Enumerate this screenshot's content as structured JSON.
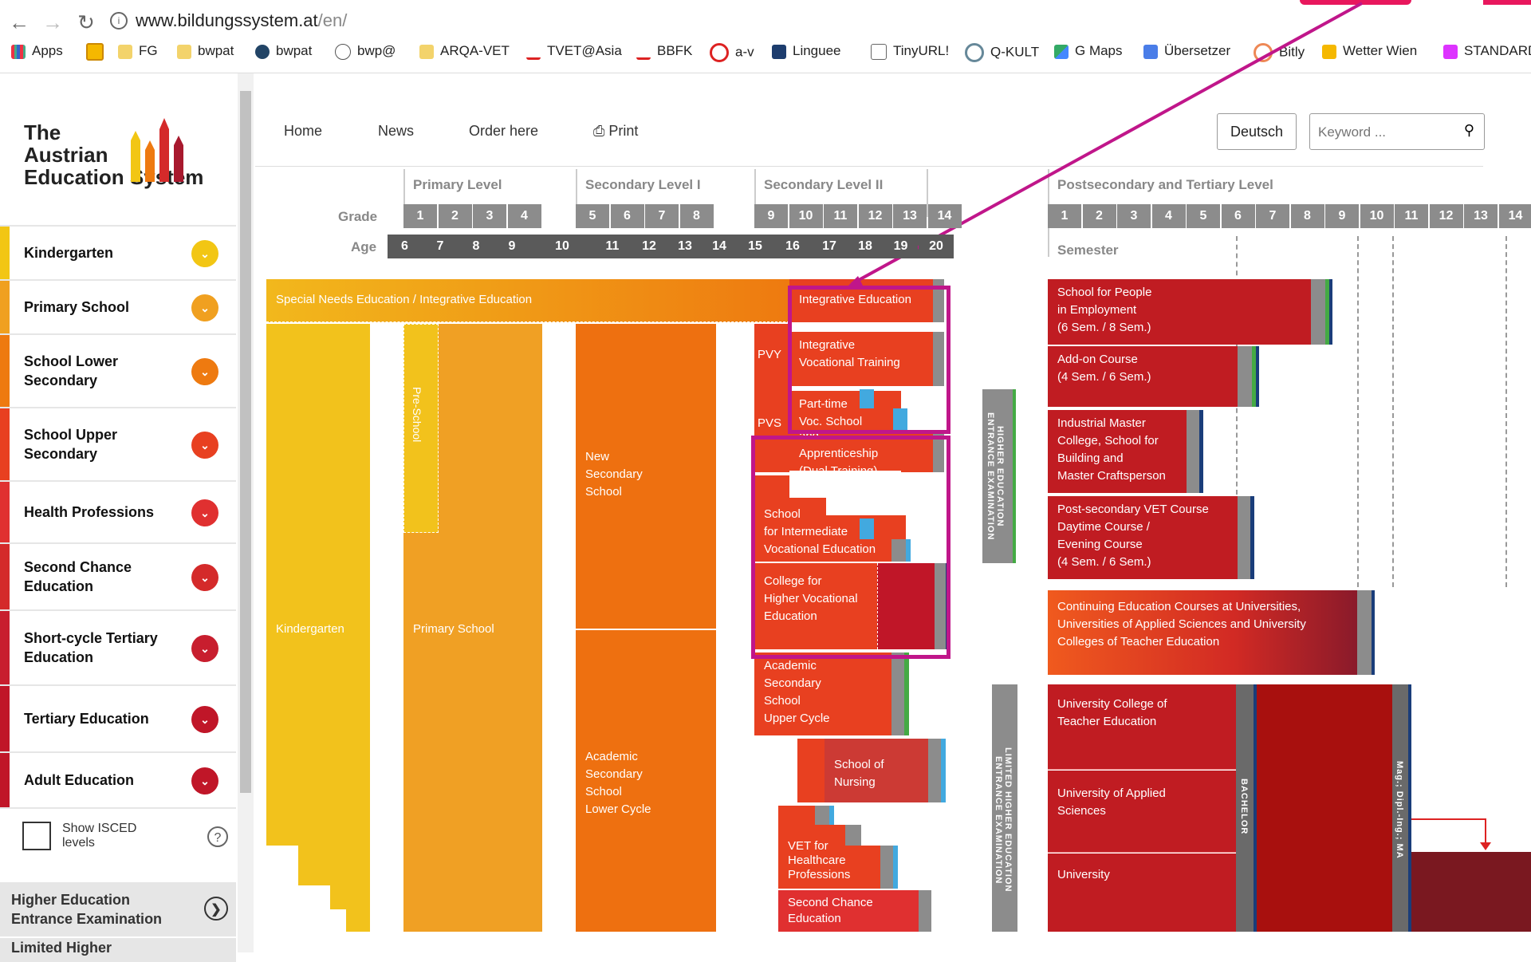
{
  "browser": {
    "url_host": "www.bildungssystem.at",
    "url_path": "/en/",
    "bookmarks": [
      "Apps",
      "FG",
      "bwpat",
      "bwpat",
      "bwp@",
      "ARQA-VET",
      "TVET@Asia",
      "BBFK",
      "a-v",
      "Linguee",
      "TinyURL!",
      "Q-KULT",
      "G Maps",
      "Übersetzer",
      "Bitly",
      "Wetter Wien",
      "STANDARD"
    ]
  },
  "logo": {
    "line1": "The",
    "line2": "Austrian",
    "line3": "Education System"
  },
  "sidebar": {
    "items": [
      {
        "label1": "Kindergarten",
        "label2": "",
        "color": "#f2c614"
      },
      {
        "label1": "Primary School",
        "label2": "",
        "color": "#f0a020"
      },
      {
        "label1": "School Lower",
        "label2": "Secondary",
        "color": "#ee7a10"
      },
      {
        "label1": "School Upper",
        "label2": "Secondary",
        "color": "#e84020"
      },
      {
        "label1": "Health Professions",
        "label2": "",
        "color": "#e03030"
      },
      {
        "label1": "Second Chance",
        "label2": "Education",
        "color": "#d42a2a"
      },
      {
        "label1": "Short-cycle Tertiary",
        "label2": "Education",
        "color": "#c81e2e"
      },
      {
        "label1": "Tertiary Education",
        "label2": "",
        "color": "#c01628"
      },
      {
        "label1": "Adult Education",
        "label2": "",
        "color": "#c01628"
      }
    ],
    "isced_label1": "Show ISCED",
    "isced_label2": "levels",
    "help": "?",
    "gray1_a": "Higher Education",
    "gray1_b": "Entrance Examination",
    "gray2": "Limited Higher"
  },
  "topnav": {
    "home": "Home",
    "news": "News",
    "order": "Order here",
    "print": "Print",
    "lang": "Deutsch",
    "search_placeholder": "Keyword ..."
  },
  "levels": {
    "primary": "Primary Level",
    "sec1": "Secondary Level I",
    "sec2": "Secondary Level II",
    "tertiary": "Postsecondary and Tertiary Level",
    "grade": "Grade",
    "age": "Age",
    "semester": "Semester"
  },
  "grades_primary": [
    "1",
    "2",
    "3",
    "4"
  ],
  "grades_sec1": [
    "5",
    "6",
    "7",
    "8"
  ],
  "grades_sec2": [
    "9",
    "10",
    "11",
    "12",
    "13",
    "14"
  ],
  "semesters": [
    "1",
    "2",
    "3",
    "4",
    "5",
    "6",
    "7",
    "8",
    "9",
    "10",
    "11",
    "12",
    "13",
    "14"
  ],
  "ages": [
    "6",
    "7",
    "8",
    "9",
    "10",
    "11",
    "12",
    "13",
    "14",
    "15",
    "16",
    "17",
    "18",
    "19",
    "20"
  ],
  "blocks": {
    "sne": "Special Needs Education / Integrative Education",
    "integ": "Integrative Education",
    "kinder": "Kindergarten",
    "preschool": "Pre-School",
    "primary": "Primary School",
    "nss": [
      "New",
      "Secondary",
      "School"
    ],
    "asslc": [
      "Academic",
      "Secondary",
      "School",
      "Lower Cycle"
    ],
    "pvy": "PVY",
    "pvs": "PVS",
    "ivt": [
      "Integrative",
      "Vocational Training"
    ],
    "pts": [
      "Part-time",
      "Voc. School"
    ],
    "dual": [
      "and Apprenticeship",
      "(Dual Training)"
    ],
    "sive": [
      "School",
      "for Intermediate",
      "Vocational Education"
    ],
    "chve": [
      "College for",
      "Higher Vocational",
      "Education"
    ],
    "assuc": [
      "Academic",
      "Secondary",
      "School",
      "Upper Cycle"
    ],
    "nursing": [
      "School of",
      "Nursing"
    ],
    "vet": [
      "VET for",
      "Healthcare",
      "Professions"
    ],
    "second": [
      "Second Chance",
      "Education"
    ],
    "heee": [
      "HIGHER EDUCATION",
      "ENTRANCE EXAMINATION"
    ],
    "lheee": [
      "LIMITED HIGHER EDUCATION",
      "ENTRANCE EXAMINATION"
    ],
    "spe": [
      "School for People",
      "in Employment",
      "(6 Sem. / 8 Sem.)"
    ],
    "addon": [
      "Add-on Course",
      "(4 Sem. / 6 Sem.)"
    ],
    "imc": [
      "Industrial Master",
      "College, School for",
      "Building and",
      "Master Craftsperson"
    ],
    "psv": [
      "Post-secondary VET Course",
      "Daytime Course /",
      "Evening Course",
      "(4 Sem. / 6 Sem.)"
    ],
    "ce": [
      "Continuing Education Courses at Universities,",
      "Universities of Applied Sciences and University",
      "Colleges of Teacher Education"
    ],
    "uct": [
      "University College of",
      "Teacher Education"
    ],
    "uas": [
      "University of Applied",
      "Sciences"
    ],
    "uni": "University",
    "bachelor": "BACHELOR",
    "master": "Mag.; Dipl.-Ing.; MA"
  }
}
